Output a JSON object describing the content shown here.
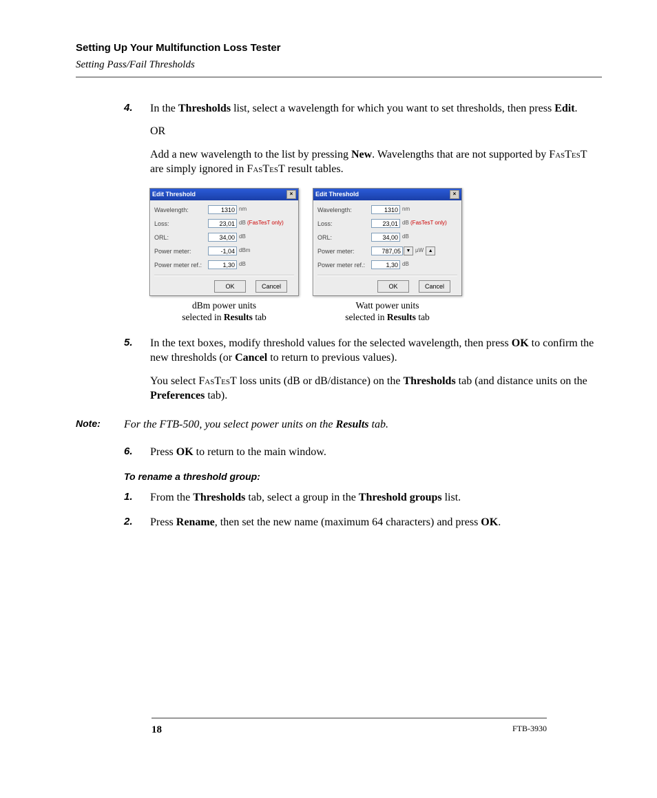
{
  "header": {
    "title": "Setting Up Your Multifunction Loss Tester",
    "subtitle": "Setting Pass/Fail Thresholds"
  },
  "steps": {
    "s4_num": "4.",
    "s4_p1a": "In the ",
    "s4_p1b": "Thresholds",
    "s4_p1c": " list, select a wavelength for which you want to set thresholds, then press ",
    "s4_p1d": "Edit",
    "s4_p1e": ".",
    "s4_or": "OR",
    "s4_p2a": "Add a new wavelength to the list by pressing ",
    "s4_p2b": "New",
    "s4_p2c": ". Wavelengths that are not supported by ",
    "s4_fastest1": "FasTesT",
    "s4_p2d": " are simply ignored in ",
    "s4_fastest2": "FasTesT",
    "s4_p2e": " result tables.",
    "s5_num": "5.",
    "s5_p1a": "In the text boxes, modify threshold values for the selected wavelength, then press ",
    "s5_p1b": "OK",
    "s5_p1c": " to confirm the new thresholds (or ",
    "s5_p1d": "Cancel",
    "s5_p1e": " to return to previous values).",
    "s5_p2a": "You select ",
    "s5_fastest": "FasTesT",
    "s5_p2b": " loss units (dB or dB/distance) on the ",
    "s5_p2c": "Thresholds",
    "s5_p2d": " tab (and distance units on the ",
    "s5_p2e": "Preferences",
    "s5_p2f": " tab).",
    "s6_num": "6.",
    "s6_a": "Press ",
    "s6_b": "OK",
    "s6_c": " to return to the main window.",
    "r1_num": "1.",
    "r1_a": "From the ",
    "r1_b": "Thresholds",
    "r1_c": " tab, select a group in the ",
    "r1_d": "Threshold groups",
    "r1_e": " list.",
    "r2_num": "2.",
    "r2_a": "Press ",
    "r2_b": "Rename",
    "r2_c": ", then set the new name (maximum 64 characters) and press ",
    "r2_d": "OK",
    "r2_e": "."
  },
  "note": {
    "label": "Note:",
    "a": "For the FTB-500, you select power units on the ",
    "b": "Results",
    "c": " tab."
  },
  "subheading": "To rename a threshold group:",
  "dialogs": {
    "left": {
      "title": "Edit Threshold",
      "wavelength_label": "Wavelength:",
      "wavelength_value": "1310",
      "wavelength_unit": "nm",
      "loss_label": "Loss:",
      "loss_value": "23,01",
      "loss_unit_prefix": "dB ",
      "loss_unit_hint": "(FasTesT only)",
      "orl_label": "ORL:",
      "orl_value": "34,00",
      "orl_unit": "dB",
      "pm_label": "Power meter:",
      "pm_value": "-1,04",
      "pm_unit": "dBm",
      "pmref_label": "Power meter ref.:",
      "pmref_value": "1,30",
      "pmref_unit": "dB",
      "ok": "OK",
      "cancel": "Cancel",
      "caption_l1": "dBm power units",
      "caption_l2a": "selected in ",
      "caption_l2b": "Results",
      "caption_l2c": " tab"
    },
    "right": {
      "title": "Edit Threshold",
      "wavelength_label": "Wavelength:",
      "wavelength_value": "1310",
      "wavelength_unit": "nm",
      "loss_label": "Loss:",
      "loss_value": "23,01",
      "loss_unit_prefix": "dB ",
      "loss_unit_hint": "(FasTesT only)",
      "orl_label": "ORL:",
      "orl_value": "34,00",
      "orl_unit": "dB",
      "pm_label": "Power meter:",
      "pm_value": "787,05",
      "pm_unit": "µW",
      "pmref_label": "Power meter ref.:",
      "pmref_value": "1,30",
      "pmref_unit": "dB",
      "ok": "OK",
      "cancel": "Cancel",
      "caption_l1": "Watt power units",
      "caption_l2a": "selected in ",
      "caption_l2b": "Results",
      "caption_l2c": " tab"
    }
  },
  "footer": {
    "page": "18",
    "model": "FTB-3930"
  }
}
